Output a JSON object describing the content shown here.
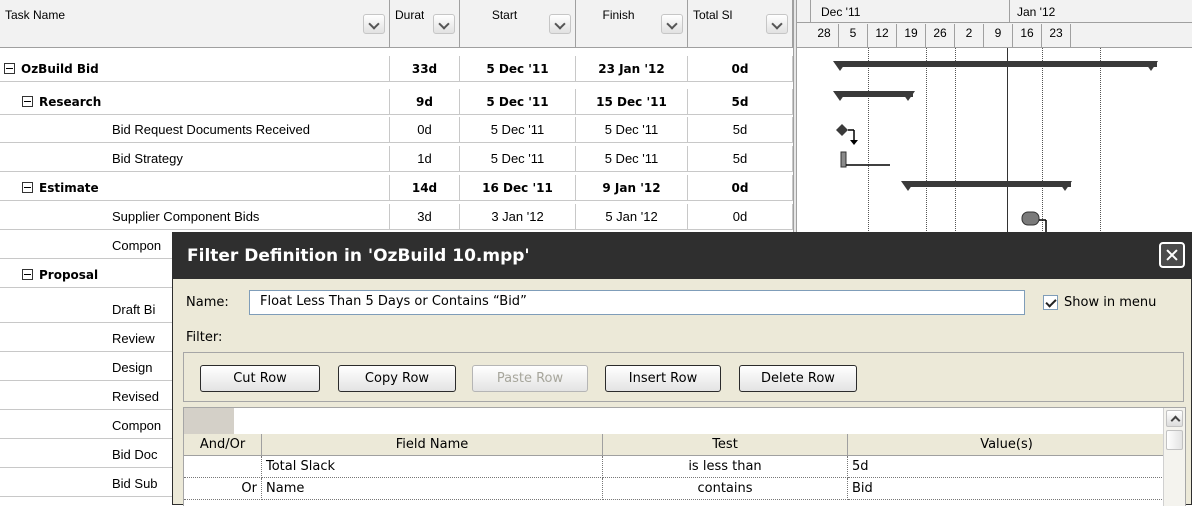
{
  "table": {
    "columns": [
      {
        "label": "Task Name"
      },
      {
        "label": "Durat"
      },
      {
        "label": "Start"
      },
      {
        "label": "Finish"
      },
      {
        "label": "Total Sl"
      }
    ],
    "rows": [
      {
        "name": "OzBuild Bid",
        "duration": "33d",
        "start": "5 Dec '11",
        "finish": "23 Jan '12",
        "slack": "0d"
      },
      {
        "name": "Research",
        "duration": "9d",
        "start": "5 Dec '11",
        "finish": "15 Dec '11",
        "slack": "5d"
      },
      {
        "name": "Bid Request Documents Received",
        "duration": "0d",
        "start": "5 Dec '11",
        "finish": "5 Dec '11",
        "slack": "5d"
      },
      {
        "name": "Bid Strategy",
        "duration": "1d",
        "start": "5 Dec '11",
        "finish": "5 Dec '11",
        "slack": "5d"
      },
      {
        "name": "Estimate",
        "duration": "14d",
        "start": "16 Dec '11",
        "finish": "9 Jan '12",
        "slack": "0d"
      },
      {
        "name": "Supplier Component Bids",
        "duration": "3d",
        "start": "3 Jan '12",
        "finish": "5 Jan '12",
        "slack": "0d"
      },
      {
        "name": "Compon"
      },
      {
        "name": "Proposal"
      },
      {
        "name": "Draft Bi"
      },
      {
        "name": "Review"
      },
      {
        "name": "Design "
      },
      {
        "name": "Revised"
      },
      {
        "name": "Compon"
      },
      {
        "name": "Bid Doc"
      },
      {
        "name": "Bid Sub"
      }
    ]
  },
  "timescale": {
    "months": [
      "Dec '11",
      "Jan '12"
    ],
    "days": [
      "28",
      "5",
      "12",
      "19",
      "26",
      "2",
      "9",
      "16",
      "23"
    ]
  },
  "dialog": {
    "title": "Filter Definition in 'OzBuild 10.mpp'",
    "name_label": "Name:",
    "name_value": "Float Less Than 5 Days or Contains “Bid”",
    "show_in_menu_label": "Show in menu",
    "show_in_menu_checked": true,
    "filter_label": "Filter:",
    "buttons": {
      "cut": "Cut Row",
      "copy": "Copy Row",
      "paste": "Paste Row",
      "insert": "Insert Row",
      "delete": "Delete Row"
    },
    "grid": {
      "headers": [
        "And/Or",
        "Field Name",
        "Test",
        "Value(s)"
      ],
      "rows": [
        {
          "andor": "",
          "field": "Total Slack",
          "test": "is less than",
          "value": "5d"
        },
        {
          "andor": "Or",
          "field": "Name",
          "test": "contains",
          "value": "Bid"
        }
      ]
    }
  }
}
